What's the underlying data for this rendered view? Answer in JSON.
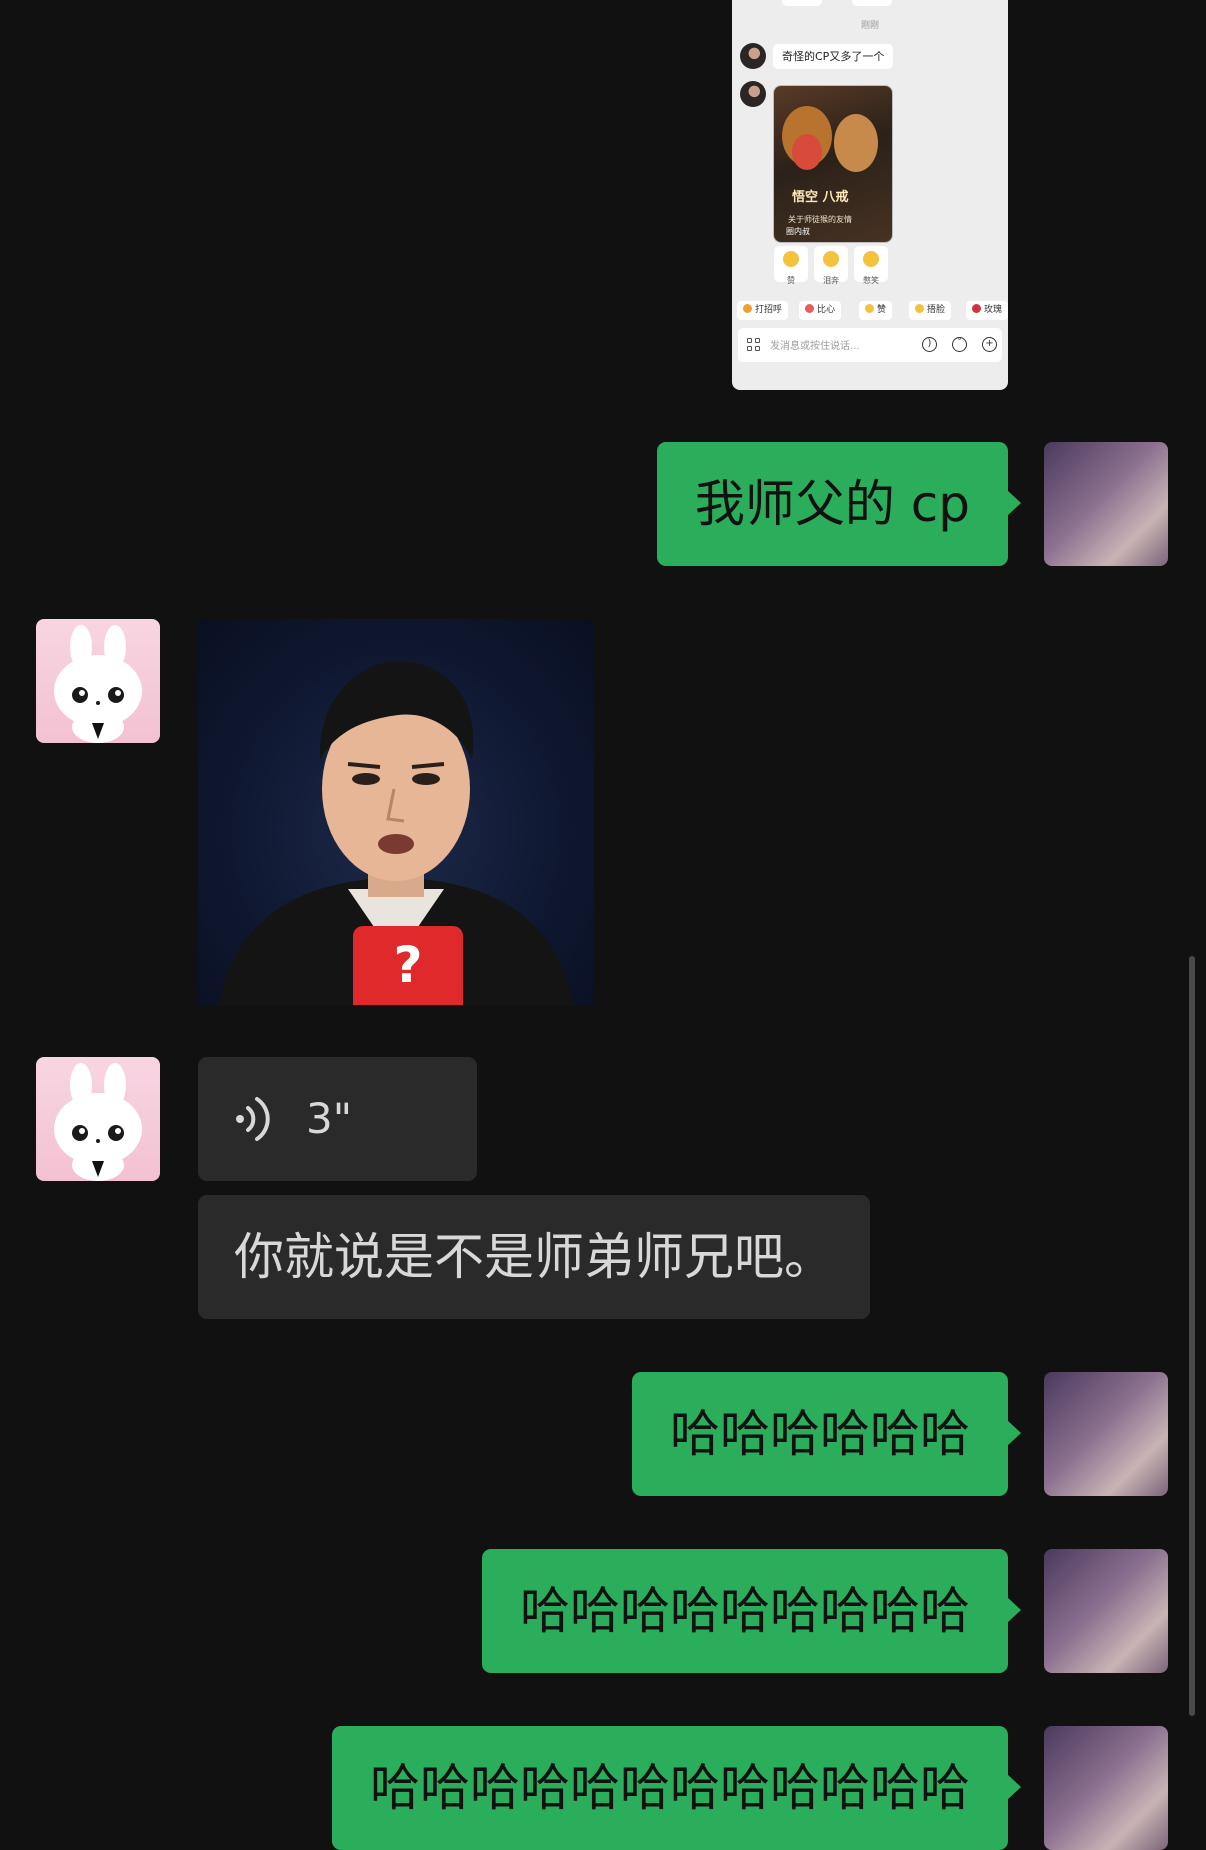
{
  "screenshot": {
    "time_label": "刚刚",
    "message": "奇怪的CP又多了一个",
    "card": {
      "title": "悟空  八戒",
      "subtitle": "关于师徒猴的友情",
      "source": "圈内叔"
    },
    "reactions": [
      {
        "label": "赞",
        "icon": "thumbs-up-icon"
      },
      {
        "label": "泪奔",
        "icon": "crying-face-icon"
      },
      {
        "label": "憋笑",
        "icon": "laughing-face-icon"
      }
    ],
    "quick_chips": [
      {
        "label": "打招呼",
        "icon": "wave-icon",
        "color": "#f0a030"
      },
      {
        "label": "比心",
        "icon": "heart-hand-icon",
        "color": "#e85c5c"
      },
      {
        "label": "赞",
        "icon": "thumbs-up-icon",
        "color": "#f4c23d"
      },
      {
        "label": "捂脸",
        "icon": "facepalm-icon",
        "color": "#f4c23d"
      },
      {
        "label": "玫瑰",
        "icon": "rose-icon",
        "color": "#d6323b"
      }
    ],
    "input_placeholder": "发消息或按住说话..."
  },
  "messages": [
    {
      "sender": "me",
      "type": "text",
      "text": "我师父的 cp"
    },
    {
      "sender": "friend",
      "type": "image",
      "overlay_text": "?"
    },
    {
      "sender": "friend",
      "type": "voice",
      "duration": "3\""
    },
    {
      "sender": "friend",
      "type": "text",
      "text": "你就说是不是师弟师兄吧。"
    },
    {
      "sender": "me",
      "type": "text",
      "text": "哈哈哈哈哈哈"
    },
    {
      "sender": "me",
      "type": "text",
      "text": "哈哈哈哈哈哈哈哈哈"
    },
    {
      "sender": "me",
      "type": "text",
      "text": "哈哈哈哈哈哈哈哈哈哈哈哈"
    }
  ],
  "colors": {
    "background": "#111111",
    "my_bubble": "#2bae5c",
    "friend_bubble": "#2a2a2a"
  }
}
